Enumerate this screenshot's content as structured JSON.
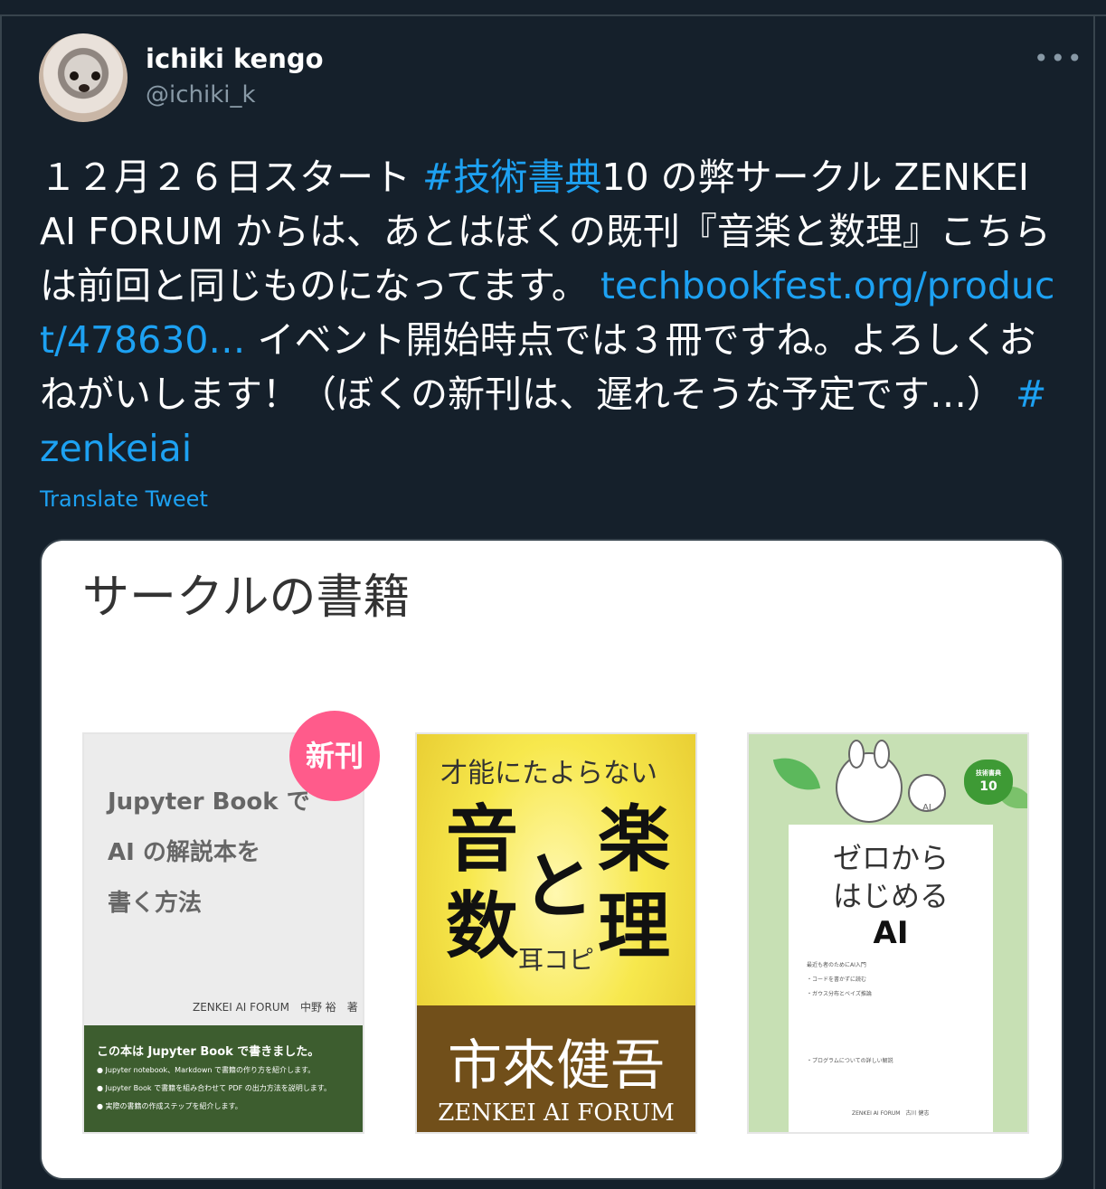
{
  "author": {
    "name": "ichiki kengo",
    "handle": "@ichiki_k"
  },
  "more_icon": "more-horizontal-icon",
  "tweet": {
    "part1": "１２月２６日スタート ",
    "hashtag1": "#技術書典",
    "part2": "10 の弊サークル ZENKEI AI FORUM からは、あとはぼくの既刊『音楽と数理』こちらは前回と同じものになってます。 ",
    "link": "techbookfest.org/product/478630…",
    "part3": " イベント開始時点では３冊ですね。よろしくおねがいします！（ぼくの新刊は、遅れそうな予定です…） ",
    "hashtag2": "#zenkeiai"
  },
  "translate_label": "Translate Tweet",
  "card": {
    "title": "サークルの書籍",
    "book1": {
      "badge": "新刊",
      "line1": "Jupyter Book で",
      "line2": "AI の解説本を",
      "line3": "書く方法",
      "author": "ZENKEI AI FORUM　中野 裕　著",
      "desc_title": "この本は Jupyter Book で書きました。",
      "bullet1": "● Jupyter notebook、Markdown で書籍の作り方を紹介します。",
      "bullet2": "● Jupyter Book で書籍を組み合わせて PDF の出力方法を説明します。",
      "bullet3": "● 実際の書籍の作成ステップを紹介します。"
    },
    "book2": {
      "subtitle": "才能にたよらない",
      "char1": "音",
      "char2": "楽",
      "char3": "と",
      "char4": "数",
      "char5": "理",
      "ear_copy": "耳コピ",
      "author": "市來健吾",
      "forum": "ZENKEI AI FORUM"
    },
    "book3": {
      "badge_top": "技術書典",
      "badge_num": "10",
      "robot_label": "AI",
      "title1": "ゼロから",
      "title2": "はじめる",
      "title3": "AI",
      "small1": "最近も者のためにAI入門",
      "small2": "・コードを書かずに読む",
      "small3": "・ガウス分布とベイズ推論",
      "small4": "・プログラムについての詳しい解説",
      "footer": "ZENKEI AI FORUM　古川 健志"
    }
  },
  "colors": {
    "background": "#15202b",
    "link": "#1da1f2",
    "secondary_text": "#8899a6",
    "badge": "#ff5b8b"
  }
}
